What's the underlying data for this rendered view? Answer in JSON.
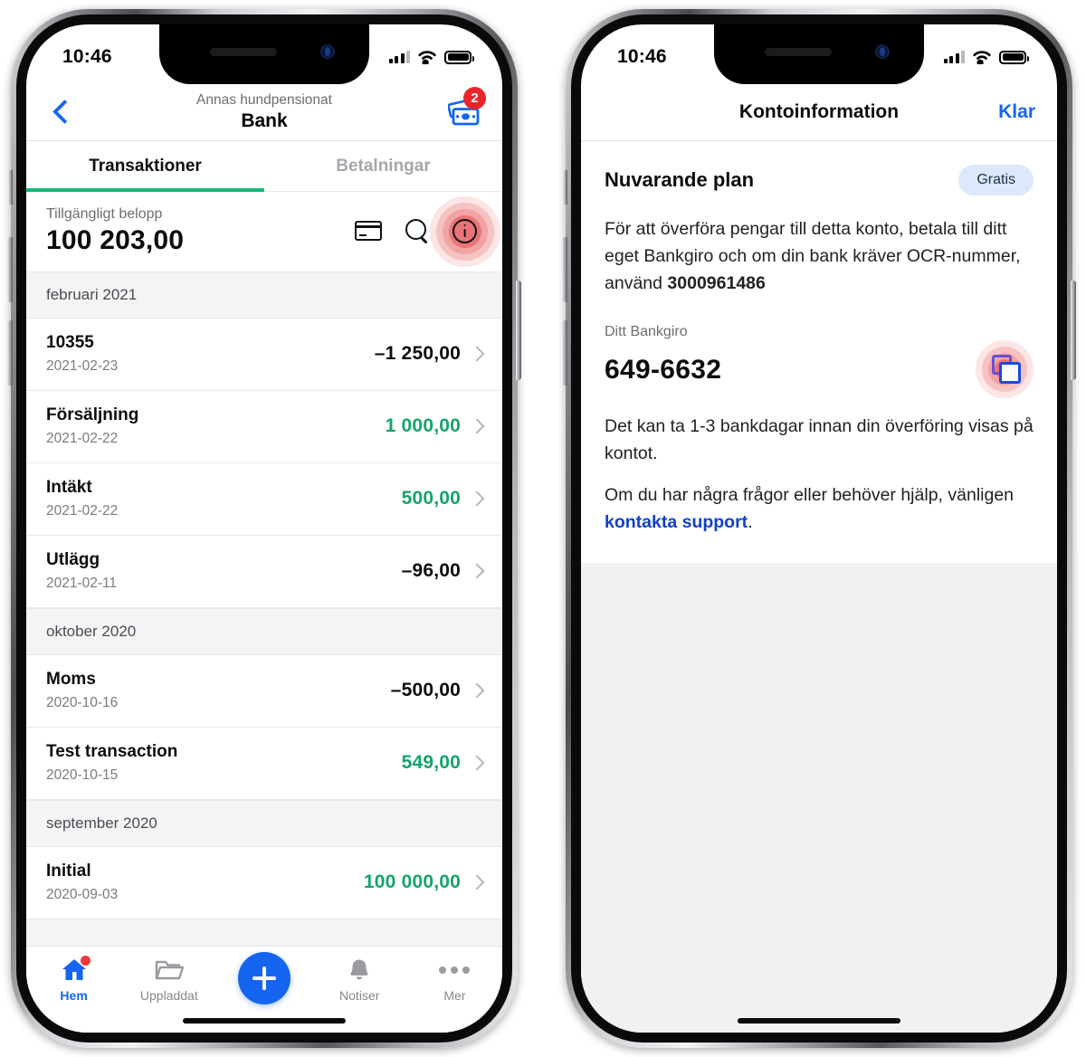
{
  "status_bar": {
    "time": "10:46",
    "cellular_icon": "cellular-bars-icon",
    "wifi_icon": "wifi-icon",
    "battery_icon": "battery-icon"
  },
  "left_phone": {
    "nav": {
      "back_icon": "chevron-left-icon",
      "subtitle": "Annas hundpensionat",
      "title": "Bank",
      "money_icon": "banknotes-icon",
      "badge_count": "2"
    },
    "tabs": [
      {
        "label": "Transaktioner",
        "active": true
      },
      {
        "label": "Betalningar",
        "active": false
      }
    ],
    "balance": {
      "label": "Tillgängligt belopp",
      "value": "100 203,00",
      "actions": [
        {
          "name": "card-icon"
        },
        {
          "name": "search-icon"
        },
        {
          "name": "info-icon",
          "highlighted": true
        }
      ]
    },
    "sections": [
      {
        "header": "februari 2021",
        "transactions": [
          {
            "name": "10355",
            "date": "2021-02-23",
            "amount": "–1 250,00",
            "sign": "neg"
          },
          {
            "name": "Försäljning",
            "date": "2021-02-22",
            "amount": "1 000,00",
            "sign": "pos"
          },
          {
            "name": "Intäkt",
            "date": "2021-02-22",
            "amount": "500,00",
            "sign": "pos"
          },
          {
            "name": "Utlägg",
            "date": "2021-02-11",
            "amount": "–96,00",
            "sign": "neg"
          }
        ]
      },
      {
        "header": "oktober 2020",
        "transactions": [
          {
            "name": "Moms",
            "date": "2020-10-16",
            "amount": "–500,00",
            "sign": "neg"
          },
          {
            "name": "Test transaction",
            "date": "2020-10-15",
            "amount": "549,00",
            "sign": "pos"
          }
        ]
      },
      {
        "header": "september 2020",
        "transactions": [
          {
            "name": "Initial",
            "date": "2020-09-03",
            "amount": "100 000,00",
            "sign": "pos"
          }
        ]
      }
    ],
    "tabbar": [
      {
        "label": "Hem",
        "icon": "home-icon",
        "active": true,
        "dot": true
      },
      {
        "label": "Uppladdat",
        "icon": "folder-icon",
        "active": false,
        "dot": false
      },
      {
        "label": "",
        "icon": "plus-circle-button",
        "active": false,
        "dot": false
      },
      {
        "label": "Notiser",
        "icon": "bell-icon",
        "active": false,
        "dot": false
      },
      {
        "label": "Mer",
        "icon": "ellipsis-icon",
        "active": false,
        "dot": false
      }
    ]
  },
  "right_phone": {
    "nav": {
      "title": "Kontoinformation",
      "done_label": "Klar"
    },
    "plan": {
      "title": "Nuvarande plan",
      "badge": "Gratis"
    },
    "paragraph_1_prefix": "För att överföra pengar till detta konto, betala till ditt eget Bankgiro och om din bank kräver OCR-nummer, använd ",
    "paragraph_1_ocr": "3000961486",
    "bankgiro": {
      "label": "Ditt Bankgiro",
      "value": "649-6632",
      "copy_icon": "copy-icon"
    },
    "paragraph_2": "Det kan ta 1-3 bankdagar innan din överföring visas på kontot.",
    "paragraph_3_prefix": "Om du har några frågor eller behöver hjälp, vänligen ",
    "paragraph_3_link": "kontakta support",
    "paragraph_3_suffix": "."
  },
  "colors": {
    "accent_blue": "#1565f0",
    "link_blue": "#1240c9",
    "green": "#16a46a",
    "tab_underline_green": "#17b978",
    "badge_red": "#e8252a",
    "tap_highlight": "#e8747a",
    "pill_bg": "#dce8fb"
  }
}
